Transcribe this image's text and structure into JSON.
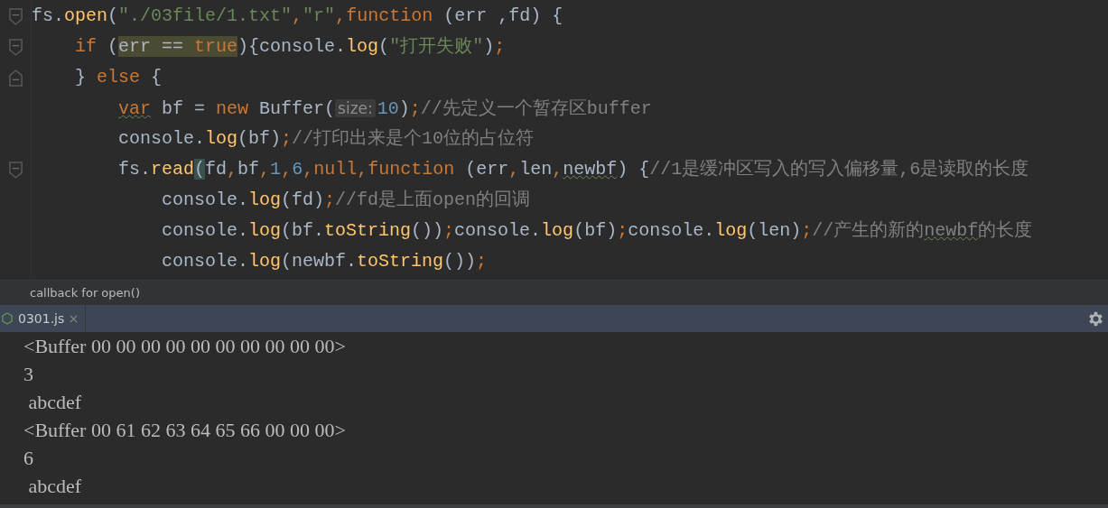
{
  "editor": {
    "lines": [
      {
        "fold_start": true,
        "tokens": [
          {
            "kind": "plain",
            "text": "fs."
          },
          {
            "kind": "function",
            "text": "open"
          },
          {
            "kind": "plain",
            "text": "("
          },
          {
            "kind": "string",
            "text": "\"./03file/1.txt\""
          },
          {
            "kind": "keyword",
            "text": ","
          },
          {
            "kind": "string",
            "text": "\"r\""
          },
          {
            "kind": "keyword",
            "text": ","
          },
          {
            "kind": "keyword",
            "text": "function"
          },
          {
            "kind": "plain",
            "text": " (err ,fd) {"
          }
        ],
        "children": [
          {
            "fold_start": true,
            "tokens": [
              {
                "kind": "keyword",
                "text": "if"
              },
              {
                "kind": "plain",
                "text": " ("
              },
              {
                "kind": "plain",
                "text": "err == ",
                "highlighted": true
              },
              {
                "kind": "keyword",
                "text": "true",
                "highlighted": true
              },
              {
                "kind": "plain",
                "text": "){console."
              },
              {
                "kind": "function",
                "text": "log"
              },
              {
                "kind": "plain",
                "text": "("
              },
              {
                "kind": "string",
                "text": "\"打开失败\""
              },
              {
                "kind": "plain",
                "text": ")"
              },
              {
                "kind": "keyword",
                "text": ";"
              }
            ]
          },
          {
            "fold_end": true,
            "tokens": [
              {
                "kind": "plain",
                "text": "} "
              },
              {
                "kind": "keyword",
                "text": "else"
              },
              {
                "kind": "plain",
                "text": " {"
              }
            ],
            "children": [
              {
                "tokens": [
                  {
                    "kind": "keyword",
                    "text": "var",
                    "warning": true
                  },
                  {
                    "kind": "plain",
                    "text": " bf = "
                  },
                  {
                    "kind": "keyword",
                    "text": "new"
                  },
                  {
                    "kind": "plain",
                    "text": " Buffer("
                  },
                  {
                    "kind": "hint",
                    "text": "size:"
                  },
                  {
                    "kind": "number",
                    "text": "10"
                  },
                  {
                    "kind": "plain",
                    "text": ")"
                  },
                  {
                    "kind": "keyword",
                    "text": ";"
                  },
                  {
                    "kind": "comment",
                    "text": "//先定义一个暂存区buffer"
                  }
                ]
              },
              {
                "tokens": [
                  {
                    "kind": "plain",
                    "text": "console."
                  },
                  {
                    "kind": "function",
                    "text": "log"
                  },
                  {
                    "kind": "plain",
                    "text": "(bf)"
                  },
                  {
                    "kind": "keyword",
                    "text": ";"
                  },
                  {
                    "kind": "comment",
                    "text": "//打印出来是个10位的占位符"
                  }
                ]
              },
              {
                "fold_start": true,
                "tokens": [
                  {
                    "kind": "plain",
                    "text": "fs."
                  },
                  {
                    "kind": "function",
                    "text": "read"
                  },
                  {
                    "kind": "plain",
                    "text": "(",
                    "brace_match": true
                  },
                  {
                    "kind": "plain",
                    "text": "fd"
                  },
                  {
                    "kind": "keyword",
                    "text": ","
                  },
                  {
                    "kind": "plain",
                    "text": "bf"
                  },
                  {
                    "kind": "keyword",
                    "text": ","
                  },
                  {
                    "kind": "number",
                    "text": "1"
                  },
                  {
                    "kind": "keyword",
                    "text": ","
                  },
                  {
                    "kind": "number",
                    "text": "6"
                  },
                  {
                    "kind": "keyword",
                    "text": ","
                  },
                  {
                    "kind": "keyword",
                    "text": "null"
                  },
                  {
                    "kind": "keyword",
                    "text": ","
                  },
                  {
                    "kind": "keyword",
                    "text": "function"
                  },
                  {
                    "kind": "plain",
                    "text": " (err"
                  },
                  {
                    "kind": "keyword",
                    "text": ","
                  },
                  {
                    "kind": "plain",
                    "text": "len"
                  },
                  {
                    "kind": "keyword",
                    "text": ","
                  },
                  {
                    "kind": "plain",
                    "text": "newbf",
                    "warning": true
                  },
                  {
                    "kind": "plain",
                    "text": ") {"
                  },
                  {
                    "kind": "comment",
                    "text": "//1是缓冲区写入的写入偏移量,6是读取的长度"
                  }
                ],
                "children": [
                  {
                    "tokens": [
                      {
                        "kind": "plain",
                        "text": "console."
                      },
                      {
                        "kind": "function",
                        "text": "log"
                      },
                      {
                        "kind": "plain",
                        "text": "(fd)"
                      },
                      {
                        "kind": "keyword",
                        "text": ";"
                      },
                      {
                        "kind": "comment",
                        "text": "//fd是上面open的回调"
                      }
                    ]
                  },
                  {
                    "tokens": [
                      {
                        "kind": "plain",
                        "text": "console."
                      },
                      {
                        "kind": "function",
                        "text": "log"
                      },
                      {
                        "kind": "plain",
                        "text": "(bf."
                      },
                      {
                        "kind": "function",
                        "text": "toString"
                      },
                      {
                        "kind": "plain",
                        "text": "())"
                      },
                      {
                        "kind": "keyword",
                        "text": ";"
                      },
                      {
                        "kind": "plain",
                        "text": "console."
                      },
                      {
                        "kind": "function",
                        "text": "log"
                      },
                      {
                        "kind": "plain",
                        "text": "(bf)"
                      },
                      {
                        "kind": "keyword",
                        "text": ";"
                      },
                      {
                        "kind": "plain",
                        "text": "console."
                      },
                      {
                        "kind": "function",
                        "text": "log"
                      },
                      {
                        "kind": "plain",
                        "text": "(len)"
                      },
                      {
                        "kind": "keyword",
                        "text": ";"
                      },
                      {
                        "kind": "comment",
                        "text": "//产生的新的"
                      },
                      {
                        "kind": "comment",
                        "text": "newbf",
                        "warning": true
                      },
                      {
                        "kind": "comment",
                        "text": "的长度"
                      }
                    ]
                  },
                  {
                    "tokens": [
                      {
                        "kind": "plain",
                        "text": "console."
                      },
                      {
                        "kind": "function",
                        "text": "log"
                      },
                      {
                        "kind": "plain",
                        "text": "(newbf."
                      },
                      {
                        "kind": "function",
                        "text": "toString"
                      },
                      {
                        "kind": "plain",
                        "text": "())"
                      },
                      {
                        "kind": "keyword",
                        "text": ";"
                      }
                    ]
                  }
                ]
              }
            ]
          }
        ]
      }
    ]
  },
  "tooltip": "callback for open()",
  "run_panel": {
    "tabs": [
      {
        "label": "0301.js",
        "selected": true
      }
    ],
    "output": [
      "<Buffer 00 00 00 00 00 00 00 00 00 00>",
      "3",
      " abcdef",
      "<Buffer 00 61 62 63 64 65 66 00 00 00>",
      "6",
      " abcdef"
    ]
  }
}
